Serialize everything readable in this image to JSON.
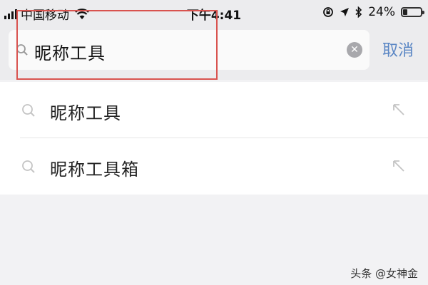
{
  "status_bar": {
    "carrier": "中国移动",
    "time": "下午4:41",
    "battery": "24%",
    "battery_level": 0.24
  },
  "search": {
    "query": "昵称工具",
    "cancel_label": "取消"
  },
  "suggestions": [
    {
      "text": "昵称工具"
    },
    {
      "text": "昵称工具箱"
    }
  ],
  "watermark": "头条 @女神金",
  "colors": {
    "accent": "#5a86c4",
    "highlight": "#d9534f"
  }
}
